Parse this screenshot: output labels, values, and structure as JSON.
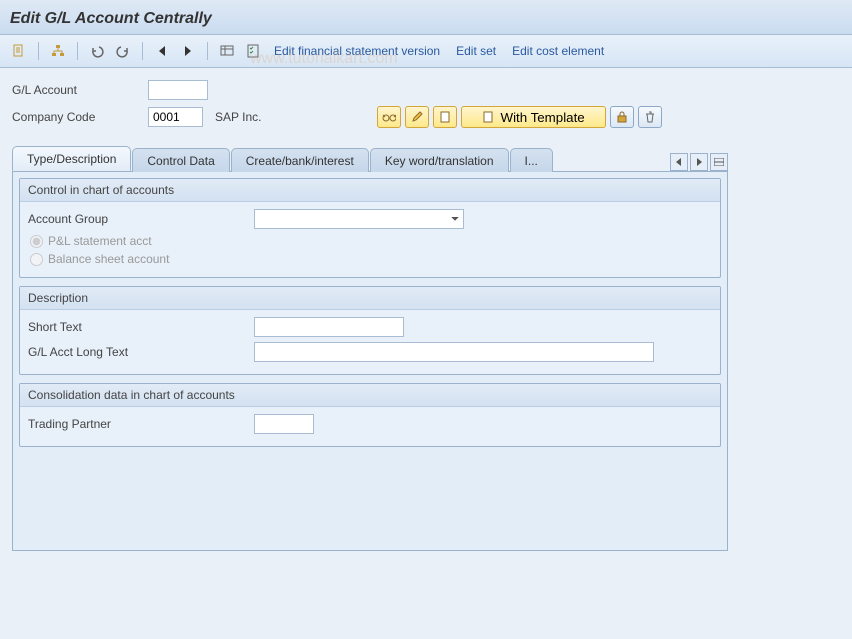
{
  "title": "Edit G/L Account Centrally",
  "toolbar": {
    "links": {
      "fsv": "Edit financial statement version",
      "set": "Edit set",
      "cost": "Edit cost element"
    }
  },
  "header": {
    "gl_account_label": "G/L Account",
    "gl_account_value": "",
    "company_code_label": "Company Code",
    "company_code_value": "0001",
    "company_name": "SAP Inc.",
    "with_template_label": "With Template"
  },
  "tabs": {
    "t1": "Type/Description",
    "t2": "Control Data",
    "t3": "Create/bank/interest",
    "t4": "Key word/translation",
    "t5": "I..."
  },
  "group1": {
    "title": "Control in chart of accounts",
    "account_group_label": "Account Group",
    "account_group_value": "",
    "radio_pl": "P&L statement acct",
    "radio_bs": "Balance sheet account"
  },
  "group2": {
    "title": "Description",
    "short_text_label": "Short Text",
    "short_text_value": "",
    "long_text_label": "G/L Acct Long Text",
    "long_text_value": ""
  },
  "group3": {
    "title": "Consolidation data in chart of accounts",
    "trading_partner_label": "Trading Partner",
    "trading_partner_value": ""
  },
  "watermark": "www.tutorialkart.com"
}
